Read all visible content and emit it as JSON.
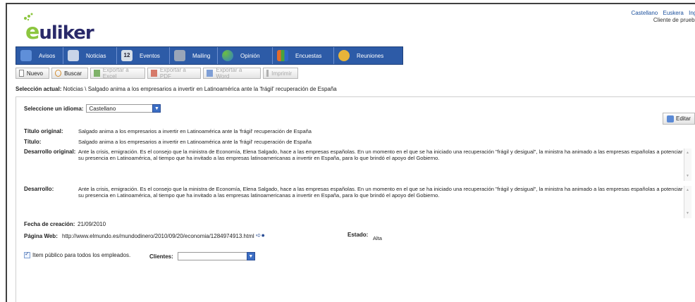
{
  "brand": {
    "name": "uliker",
    "initial": "e"
  },
  "top": {
    "languages": [
      "Castellano",
      "Euskera",
      "Ingl"
    ],
    "client_label": "Cliente de prueba"
  },
  "nav": [
    {
      "label": "Avisos",
      "icon": "megaphone-icon",
      "color": "#5f8fd9"
    },
    {
      "label": "Noticias",
      "icon": "plane-icon",
      "color": "#c9d4e8"
    },
    {
      "label": "Eventos",
      "icon": "calendar-icon",
      "color": "#d7dfe9",
      "badge": "12"
    },
    {
      "label": "Mailing",
      "icon": "document-stack-icon",
      "color": "#9aa6b8"
    },
    {
      "label": "Opinión",
      "icon": "colorful-balls-icon",
      "color": "#6cbf3f"
    },
    {
      "label": "Encuestas",
      "icon": "bar-chart-icon",
      "color": "#e36b2c"
    },
    {
      "label": "Reuniones",
      "icon": "people-icon",
      "color": "#e8b43a"
    }
  ],
  "toolbar": [
    {
      "label": "Nuevo",
      "icon": "new-document-icon",
      "enabled": true
    },
    {
      "label": "Buscar",
      "icon": "search-icon",
      "enabled": true
    },
    {
      "label": "Exportar a Excel",
      "icon": "excel-icon",
      "enabled": false
    },
    {
      "label": "Exportar a PDF",
      "icon": "pdf-icon",
      "enabled": false
    },
    {
      "label": "Exportar a Word",
      "icon": "word-icon",
      "enabled": false
    },
    {
      "label": "Imprimir",
      "icon": "printer-icon",
      "enabled": false
    }
  ],
  "breadcrumb": {
    "label": "Selección actual:",
    "value": "Noticias \\ Salgado anima a los empresarios a invertir en Latinoamérica ante la 'frágil' recuperación de España"
  },
  "language": {
    "label": "Seleccione un idioma:",
    "value": "Castellano"
  },
  "edit_label": "Editar",
  "fields": {
    "titulo_original_label": "Título original:",
    "titulo_original": "Salgado anima a los empresarios a invertir en Latinoamérica ante la 'frágil' recuperación de España",
    "titulo_label": "Título:",
    "titulo": "Salgado anima a los empresarios a invertir en Latinoamérica ante la 'frágil' recuperación de España",
    "desarrollo_original_label": "Desarrollo original:",
    "desarrollo_original": "Ante la crisis, emigración. Es el consejo que la ministra de Economía, Elena Salgado, hace a las empresas españolas. En un momento en el que se ha iniciado una recuperación \"frágil y desigual\", la ministra ha animado a las empresas españolas a potenciar su presencia en Latinoamérica, al tiempo que ha invitado a las empresas latinoamericanas a invertir en España, para lo que brindó el apoyo del Gobierno.",
    "desarrollo_label": "Desarrollo:",
    "desarrollo": "Ante la crisis, emigración. Es el consejo que la ministra de Economía, Elena Salgado, hace a las empresas españolas. En un momento en el que se ha iniciado una recuperación \"frágil y desigual\", la ministra ha animado a las empresas españolas a potenciar su presencia en Latinoamérica, al tiempo que ha invitado a las empresas latinoamericanas a invertir en España, para lo que brindó el apoyo del Gobierno.",
    "fecha_label": "Fecha de creación:",
    "fecha": "21/09/2010",
    "web_label": "Página Web:",
    "web": "http://www.elmundo.es/mundodinero/2010/09/20/economia/1284974913.html",
    "estado_label": "Estado:",
    "estado": "Alta"
  },
  "public_item": {
    "label": "Item público para todos los empleados.",
    "checked": true
  },
  "clients": {
    "label": "Clientes:",
    "value": ""
  }
}
